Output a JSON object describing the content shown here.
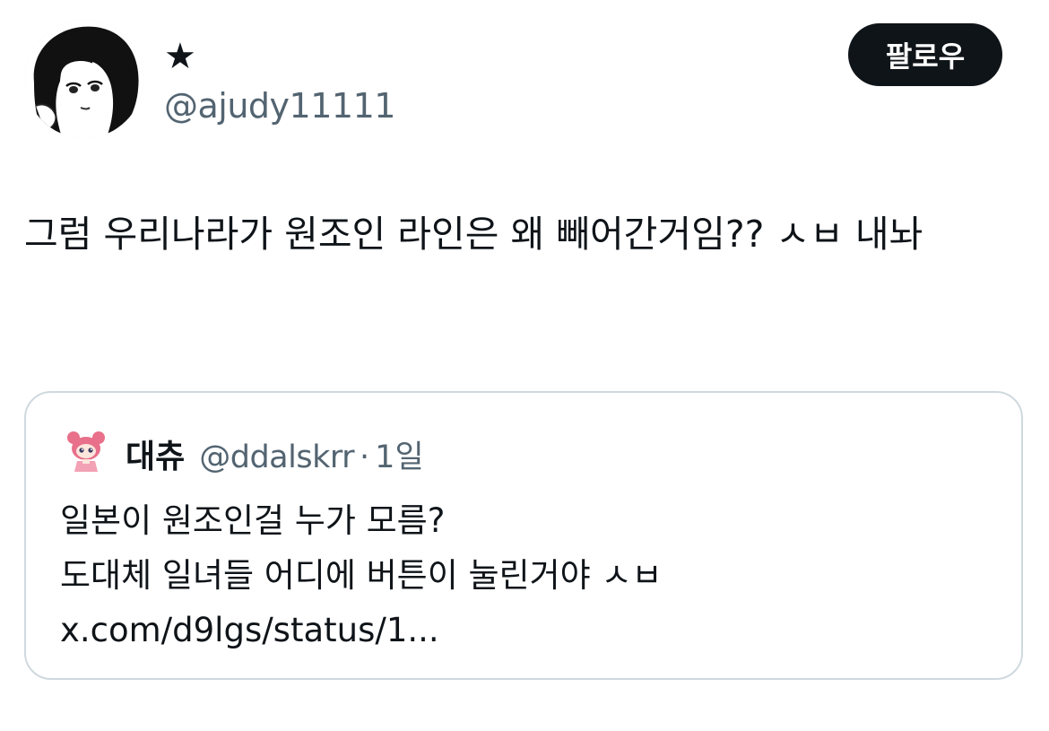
{
  "author": {
    "display_name": "★",
    "handle": "@ajudy11111",
    "avatar_icon": "anime-girl-avatar"
  },
  "follow_button": {
    "label": "팔로우"
  },
  "tweet": {
    "text": "그럼 우리나라가 원조인 라인은 왜 빼어간거임?? ㅅㅂ 내놔"
  },
  "quote": {
    "display_name": "대츄",
    "handle": "@ddalskrr",
    "separator": "·",
    "time": "1일",
    "avatar_icon": "pink-character-avatar",
    "line1": "일본이 원조인걸 누가 모름?",
    "line2_text": "도대체 일녀들 어디에 버튼이 눌린거야 ㅅㅂ ",
    "link_text": "x.com/d9lgs/status/1...",
    "link_url_display": "x.com/d9lgs/status/1..."
  },
  "colors": {
    "text_primary": "#0f1419",
    "text_secondary": "#536471",
    "border": "#cfd9de",
    "button_bg": "#0f1419",
    "button_text": "#ffffff"
  }
}
